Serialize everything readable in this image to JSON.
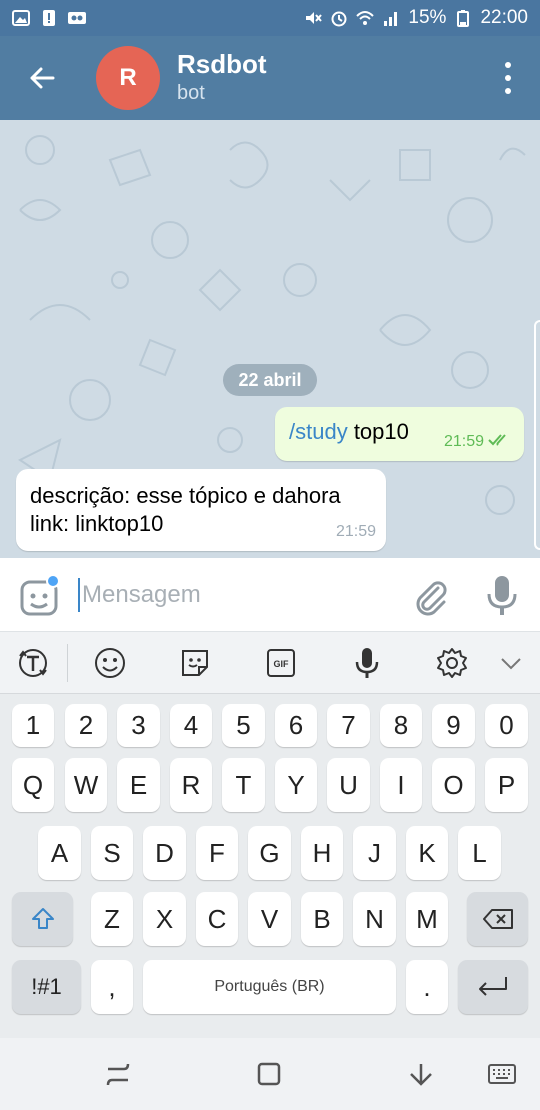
{
  "status_bar": {
    "battery": "15%",
    "time": "22:00"
  },
  "header": {
    "avatar_letter": "R",
    "title": "Rsdbot",
    "subtitle": "bot"
  },
  "chat": {
    "date_separator": "22 abril",
    "messages": [
      {
        "direction": "outgoing",
        "command": "/study",
        "text": " top10",
        "time": "21:59",
        "status": "read"
      },
      {
        "direction": "incoming",
        "line1": "descrição: esse tópico e dahora",
        "line2": "link: linktop10",
        "time": "21:59"
      }
    ]
  },
  "composer": {
    "placeholder": "Mensagem",
    "value": ""
  },
  "keyboard": {
    "toolbar_icons": [
      "text-tool-icon",
      "emoji-icon",
      "sticker-icon",
      "gif-icon",
      "voice-input-icon",
      "settings-icon",
      "chevron-down-icon"
    ],
    "number_row": [
      "1",
      "2",
      "3",
      "4",
      "5",
      "6",
      "7",
      "8",
      "9",
      "0"
    ],
    "row1": [
      "Q",
      "W",
      "E",
      "R",
      "T",
      "Y",
      "U",
      "I",
      "O",
      "P"
    ],
    "row2": [
      "A",
      "S",
      "D",
      "F",
      "G",
      "H",
      "J",
      "K",
      "L"
    ],
    "row3": [
      "Z",
      "X",
      "C",
      "V",
      "B",
      "N",
      "M"
    ],
    "symbols_key": "!#1",
    "comma_key": ",",
    "space_label": "Português (BR)",
    "period_key": "."
  },
  "colors": {
    "header": "#517da2",
    "statusbar": "#4a76a0",
    "avatar": "#e56555",
    "outgoing_bubble": "#effdde",
    "accent": "#3a86c8"
  }
}
